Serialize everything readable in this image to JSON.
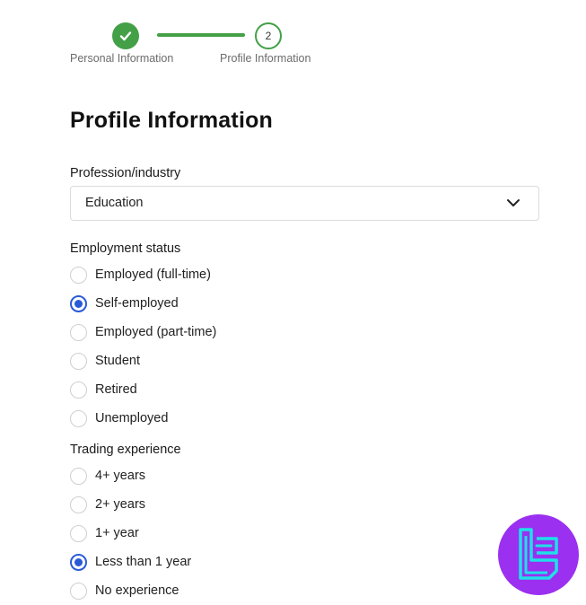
{
  "stepper": {
    "steps": [
      {
        "label": "Personal Information",
        "status": "completed"
      },
      {
        "label": "Profile Information",
        "number": "2",
        "status": "current"
      }
    ]
  },
  "page": {
    "title": "Profile Information"
  },
  "profession": {
    "label": "Profession/industry",
    "value": "Education"
  },
  "employment": {
    "label": "Employment status",
    "options": [
      {
        "label": "Employed (full-time)",
        "selected": false
      },
      {
        "label": "Self-employed",
        "selected": true
      },
      {
        "label": "Employed (part-time)",
        "selected": false
      },
      {
        "label": "Student",
        "selected": false
      },
      {
        "label": "Retired",
        "selected": false
      },
      {
        "label": "Unemployed",
        "selected": false
      }
    ]
  },
  "trading": {
    "label": "Trading experience",
    "options": [
      {
        "label": "4+ years",
        "selected": false
      },
      {
        "label": "2+ years",
        "selected": false
      },
      {
        "label": "1+ year",
        "selected": false
      },
      {
        "label": "Less than 1 year",
        "selected": true
      },
      {
        "label": "No experience",
        "selected": false
      }
    ]
  },
  "colors": {
    "step_green": "#43a047",
    "radio_blue": "#2a5bd7",
    "logo_purple": "#9b30f0",
    "logo_cyan": "#1ee0e8"
  },
  "icons": {
    "step_complete": "check-icon",
    "select": "chevron-down-icon",
    "logo": "brand-logo-icon"
  }
}
